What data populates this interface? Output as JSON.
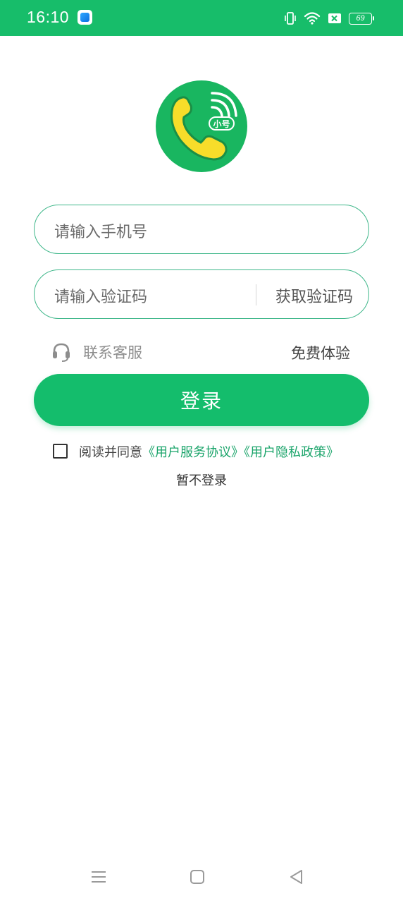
{
  "status_bar": {
    "time": "16:10",
    "battery": "69",
    "icons": [
      "app-notification-icon",
      "vibrate-icon",
      "wifi-icon",
      "sim-no-signal-icon",
      "battery-icon"
    ]
  },
  "logo": {
    "badge": "小号",
    "icon": "phone-signal-logo"
  },
  "form": {
    "phone_placeholder": "请输入手机号",
    "code_placeholder": "请输入验证码",
    "get_code_label": "获取验证码"
  },
  "links": {
    "support_label": "联系客服",
    "support_icon": "headset-icon",
    "trial_label": "免费体验"
  },
  "login_button": "登录",
  "agreement": {
    "prefix": "阅读并同意",
    "terms": "《用户服务协议》",
    "privacy": "《用户隐私政策》",
    "checked": false
  },
  "skip_label": "暂不登录",
  "nav_bar": {
    "icons": [
      "menu-icon",
      "home-icon",
      "back-icon"
    ]
  },
  "colors": {
    "accent": "#14bd6c",
    "status_bar": "#17bd6a",
    "field_border": "#3fb78a",
    "link": "#1aa46a",
    "logo_phone": "#f7dd2a"
  }
}
